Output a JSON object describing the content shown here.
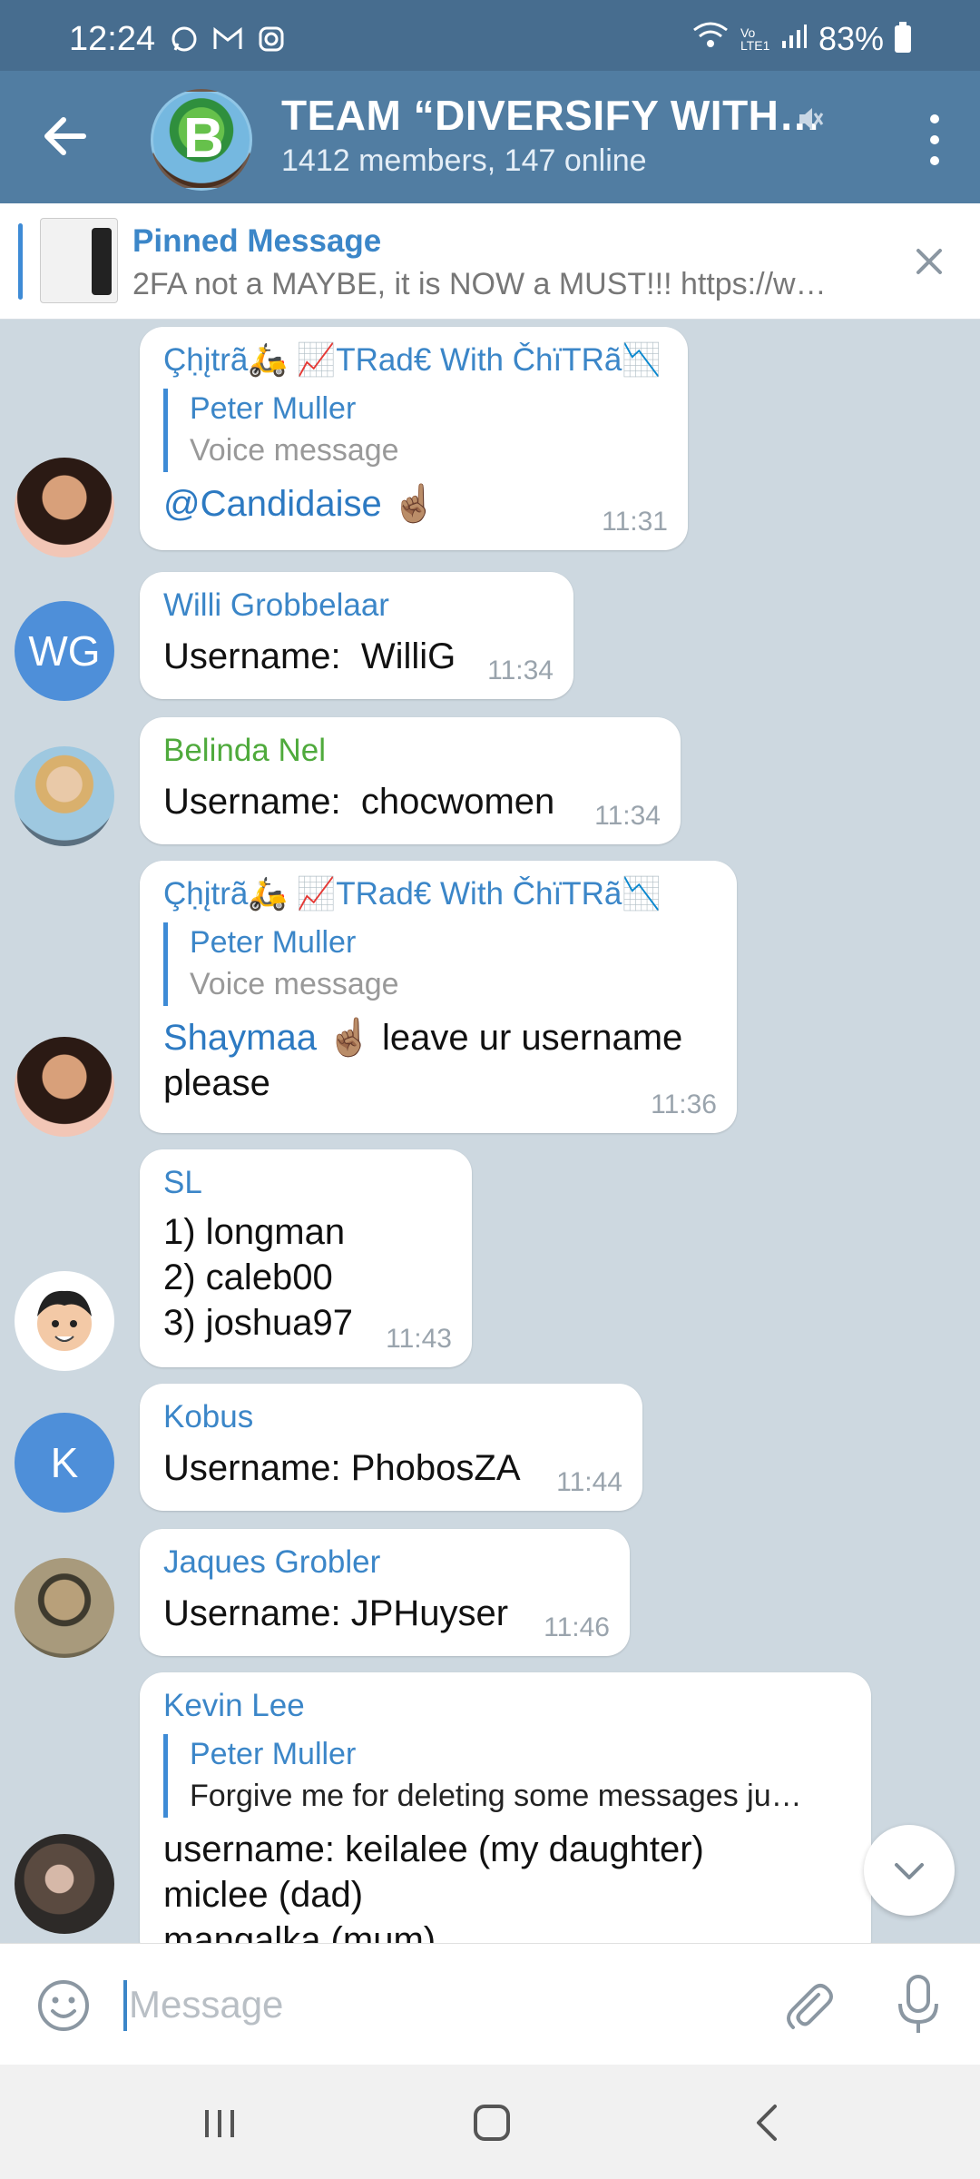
{
  "status_bar": {
    "time": "12:24",
    "signal_text": "Vo LTE1",
    "battery": "83%",
    "icons": [
      "whatsapp-icon",
      "gmail-icon",
      "instagram-icon",
      "wifi-icon",
      "signal-icon",
      "battery-icon"
    ]
  },
  "header": {
    "title": "TEAM “DIVERSIFY WITH…",
    "subtitle": "1412 members, 147 online",
    "muted": true
  },
  "pinned": {
    "label": "Pinned Message",
    "text": "2FA not a MAYBE, it is NOW a MUST!!! https://w…"
  },
  "messages": [
    {
      "sender": "Çḥįtrã🛵 📈TRad€ With ČhïTRã📉",
      "reply_name": "Peter Muller",
      "reply_text": "Voice message",
      "mention": "@Candidaise",
      "text": " ☝🏽",
      "time": "11:31"
    },
    {
      "sender": "Willi Grobbelaar",
      "avatar_initials": "WG",
      "text": "Username:  WilliG",
      "time": "11:34"
    },
    {
      "sender": "Belinda Nel",
      "sender_color": "#4faa3c",
      "text": "Username:  chocwomen",
      "time": "11:34"
    },
    {
      "sender": "Çḥįtrã🛵 📈TRad€ With ČhïTRã📉",
      "reply_name": "Peter Muller",
      "reply_text": "Voice message",
      "mention": "Shaymaa",
      "text": " ☝🏽 leave ur username\nplease",
      "time": "11:36"
    },
    {
      "sender": "SL",
      "text": "1) longman\n2) caleb00\n3) joshua97",
      "time": "11:43"
    },
    {
      "sender": "Kobus",
      "avatar_initials": "K",
      "text": "Username: PhobosZA",
      "time": "11:44"
    },
    {
      "sender": "Jaques Grobler",
      "text": "Username: JPHuyser",
      "time": "11:46"
    },
    {
      "sender": "Kevin Lee",
      "reply_name": "Peter Muller",
      "reply_text": "Forgive me for deleting some messages ju…",
      "text": "username: keilalee (my daughter)\nmiclee (dad)\nmangalka (mum)"
    }
  ],
  "composer": {
    "placeholder": "Message"
  }
}
